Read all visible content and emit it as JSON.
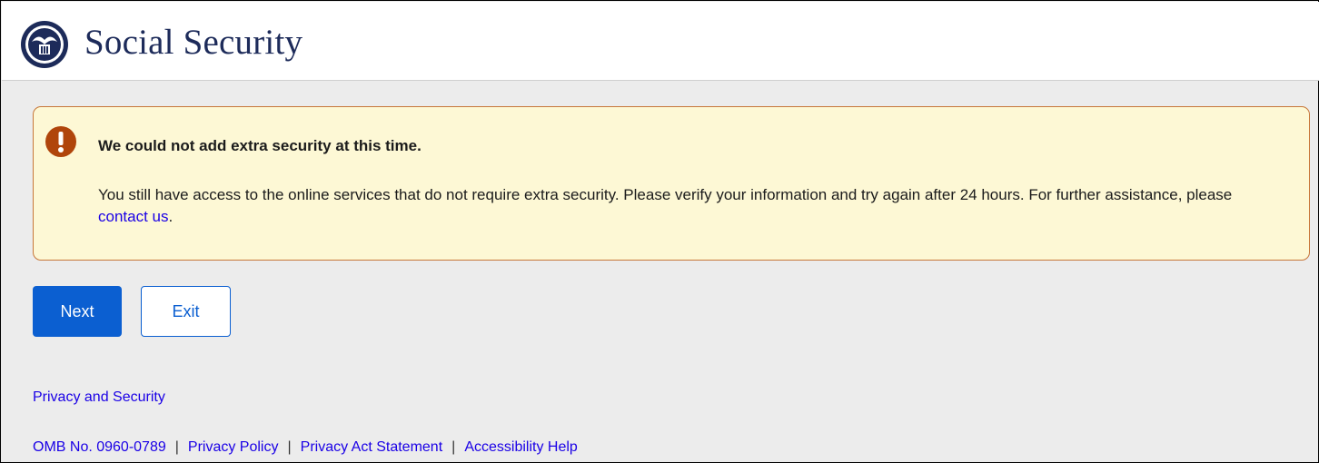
{
  "header": {
    "brand": "Social Security",
    "seal_icon": "ssa-seal-icon",
    "colors": {
      "brand_text": "#1d2b5a",
      "header_bg": "#ffffff"
    }
  },
  "alert": {
    "icon": "exclamation-circle-icon",
    "title": "We could not add extra security at this time.",
    "body_text": "You still have access to the online services that do not require extra security. Please verify your information and try again after 24 hours. For further assistance, please ",
    "link_text": "contact us",
    "body_end": ".",
    "colors": {
      "background": "#fdf8d5",
      "border": "#c7773a",
      "icon": "#b0450b"
    }
  },
  "buttons": {
    "next_label": "Next",
    "exit_label": "Exit",
    "colors": {
      "primary": "#0b5fd1"
    }
  },
  "footer": {
    "privacy_security": "Privacy and Security",
    "omb": "OMB No. 0960-0789",
    "privacy_policy": "Privacy Policy",
    "privacy_act": "Privacy Act Statement",
    "accessibility": "Accessibility Help",
    "separator": "|",
    "colors": {
      "link": "#1a00e6"
    }
  }
}
